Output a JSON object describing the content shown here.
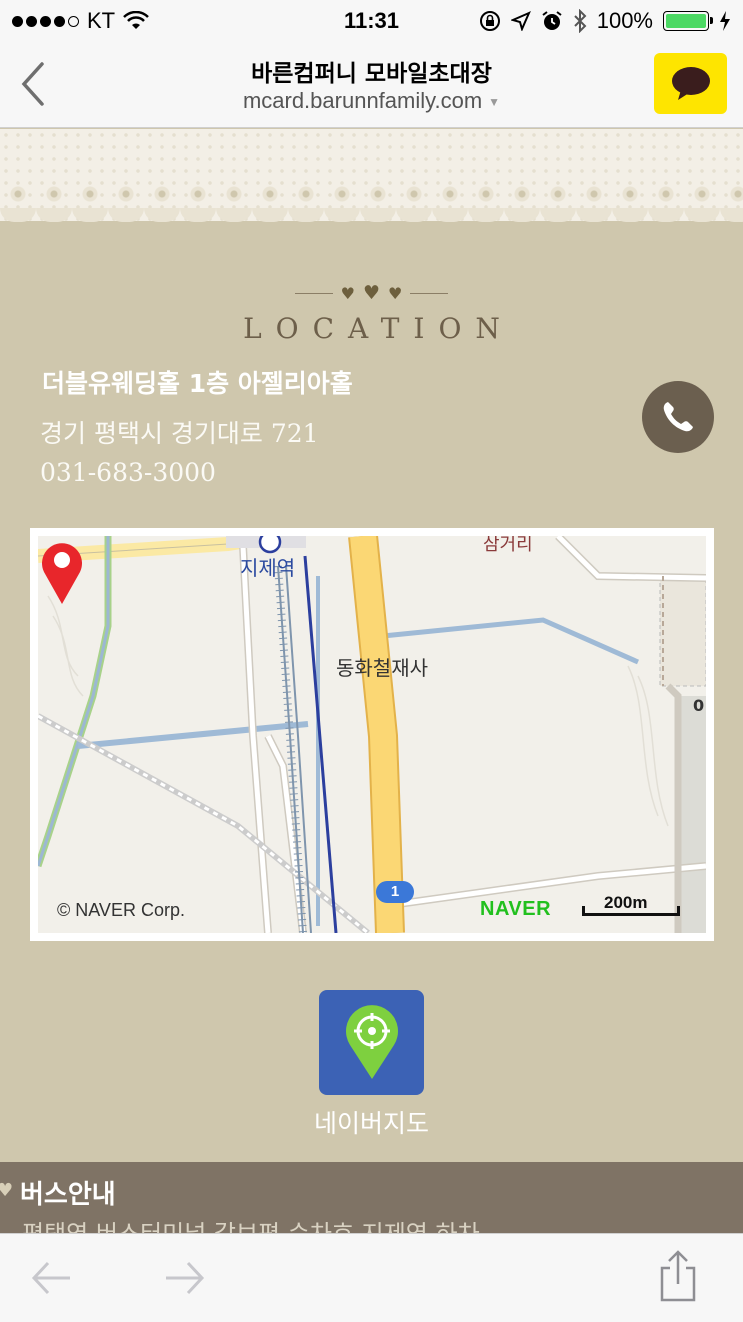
{
  "status_bar": {
    "carrier": "KT",
    "time": "11:31",
    "battery_percent": "100%",
    "battery_level": 1.0,
    "signal_bars": 4,
    "icons": [
      "wifi-icon",
      "orientation-lock-icon",
      "location-arrow-icon",
      "alarm-icon",
      "bluetooth-icon",
      "charging-bolt-icon"
    ]
  },
  "nav": {
    "title": "바른컴퍼니 모바일초대장",
    "url": "mcard.barunnfamily.com",
    "back_icon": "chevron-left-icon",
    "kakao_icon": "kakaotalk-icon",
    "kakao_color": "#fee500"
  },
  "location": {
    "heading": "LOCATION",
    "venue_name": "더블유웨딩홀 1층 아젤리아홀",
    "address": "경기 평택시 경기대로 721",
    "phone": "031-683-3000",
    "phone_icon": "phone-icon"
  },
  "map": {
    "station_label": "지제역",
    "place_label": "동화철재사",
    "top_label": "삼거리",
    "edge_label": "0",
    "copyright": "© NAVER Corp.",
    "brand": "NAVER",
    "scale": "200m",
    "route_number": "1",
    "marker_color": "#e8262b"
  },
  "naver_map": {
    "label": "네이버지도",
    "icon": "map-pin-target-icon",
    "color": "#3c62b5"
  },
  "bus": {
    "title": "버스안내",
    "text": "평택역 버스터미널 갈보평 순차호 지제역 하차"
  },
  "toolbar": {
    "back_icon": "arrow-left-icon",
    "forward_icon": "arrow-right-icon",
    "share_icon": "share-icon"
  }
}
